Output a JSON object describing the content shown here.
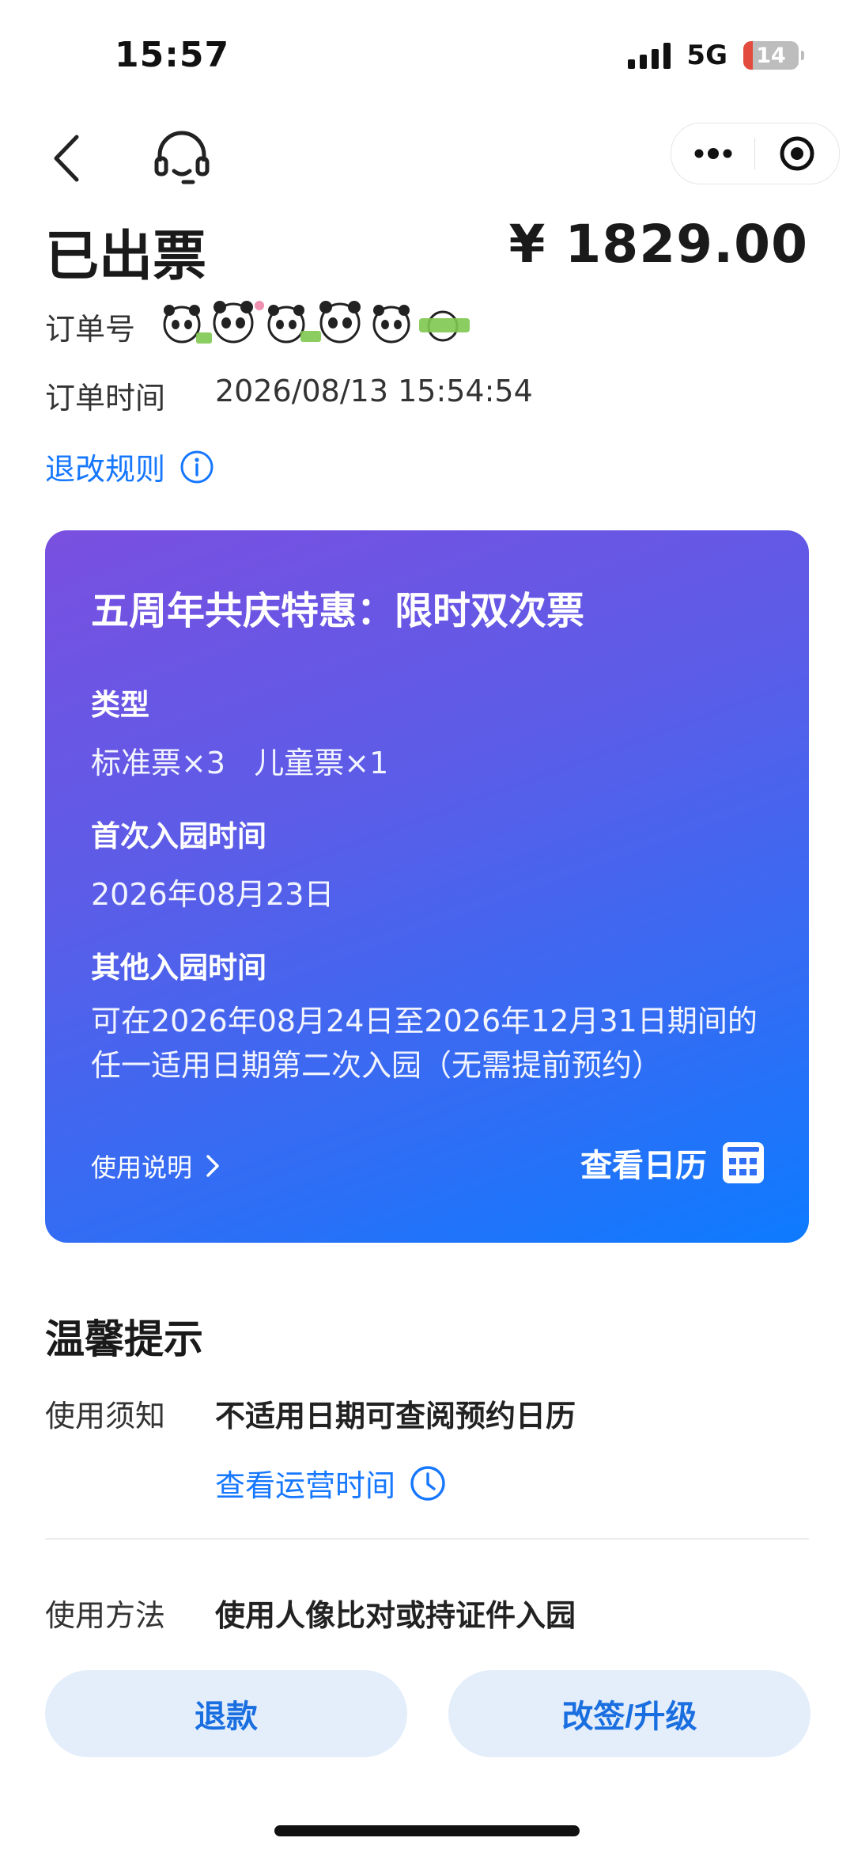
{
  "status_bar": {
    "time": "15:57",
    "network": "5G",
    "battery": "14"
  },
  "header": {
    "order_status": "已出票",
    "price": "¥ 1829.00",
    "order_no_label": "订单号",
    "order_time_label": "订单时间",
    "order_time_value": "2026/08/13 15:54:54",
    "refund_rules_label": "退改规则"
  },
  "ticket": {
    "title": "五周年共庆特惠：限时双次票",
    "type_label": "类型",
    "type_value": "标准票×3   儿童票×1",
    "first_entry_label": "首次入园时间",
    "first_entry_value": "2026年08月23日",
    "other_entry_label": "其他入园时间",
    "other_entry_value": "可在2026年08月24日至2026年12月31日期间的任一适用日期第二次入园（无需提前预约）",
    "usage_link": "使用说明",
    "calendar_link": "查看日历"
  },
  "tips": {
    "title": "温馨提示",
    "notice_label": "使用须知",
    "notice_value": "不适用日期可查阅预约日历",
    "operating_time_link": "查看运营时间",
    "method_label": "使用方法",
    "method_value": "使用人像比对或持证件入园"
  },
  "actions": {
    "refund": "退款",
    "change": "改签/升级"
  },
  "colors": {
    "accent": "#1677ff",
    "card_start": "#7a4fe0",
    "card_end": "#0d7bff",
    "button_bg": "#e4eefb"
  }
}
